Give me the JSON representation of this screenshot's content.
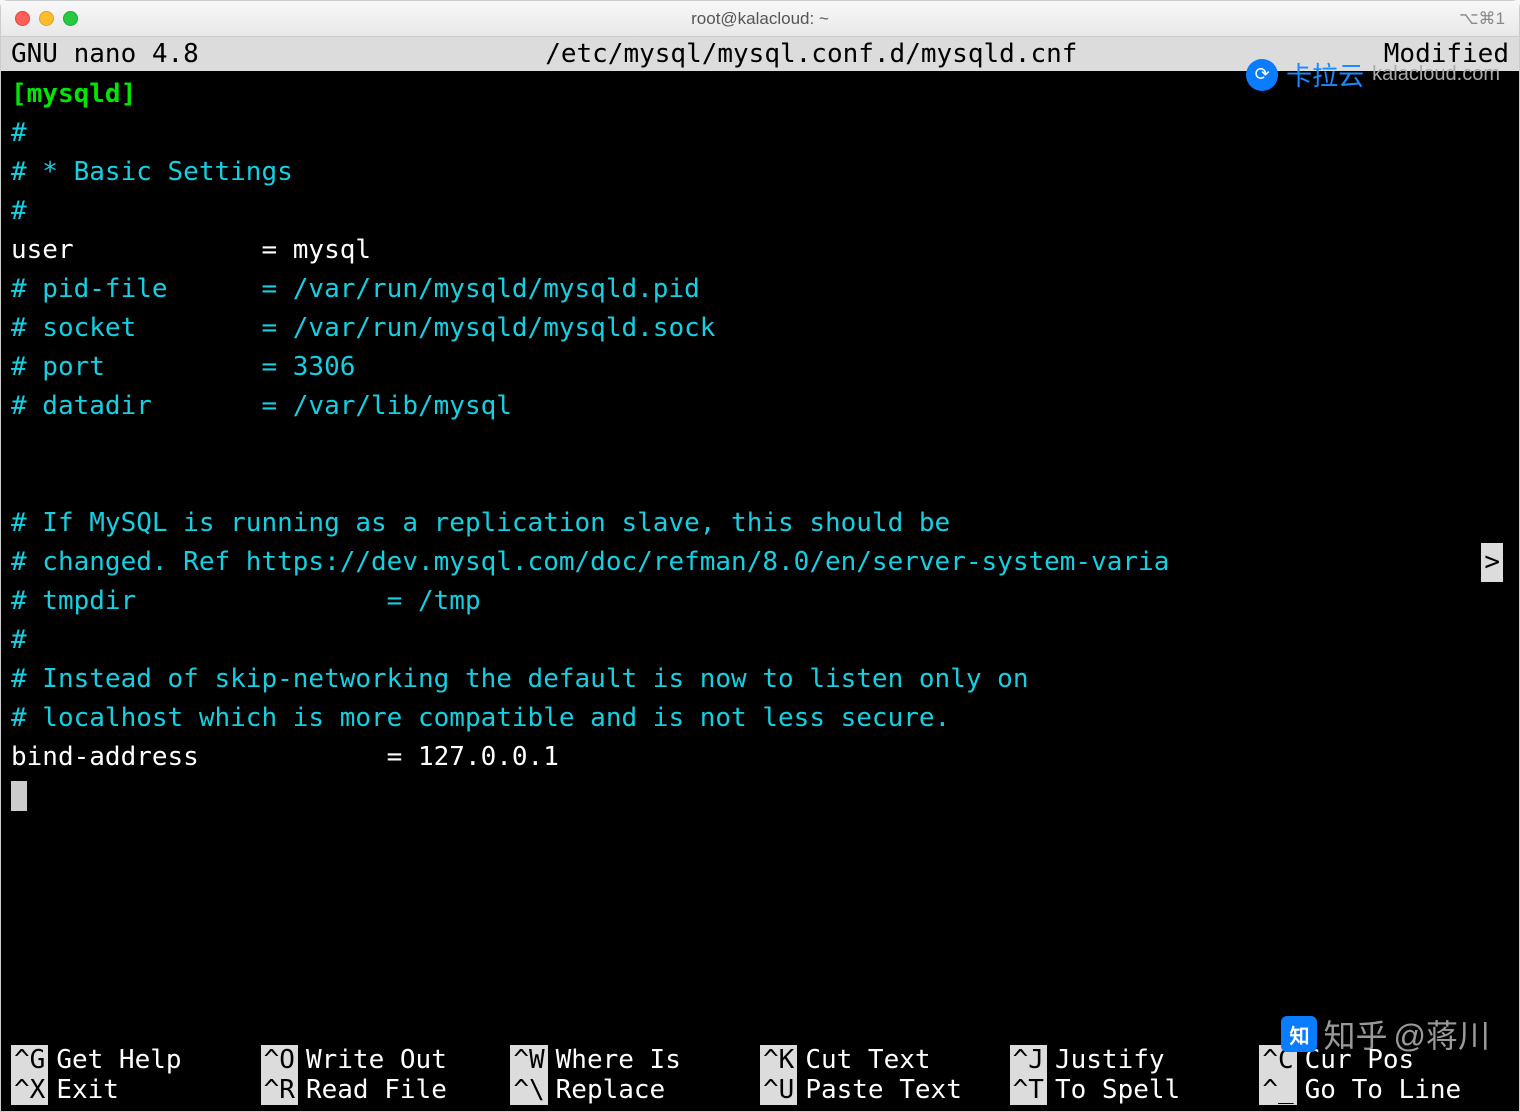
{
  "titlebar": {
    "title": "root@kalacloud: ~",
    "right_icons": "⌥⌘1"
  },
  "nano_header": {
    "app": "  GNU nano 4.8",
    "filepath": "/etc/mysql/mysql.conf.d/mysqld.cnf",
    "status": "Modified"
  },
  "watermark_top": {
    "brand_cn": "卡拉云",
    "brand_en": "kalacloud.com"
  },
  "watermark_bottom": {
    "platform": "知乎",
    "author": "@蒋川"
  },
  "content": {
    "lines": [
      {
        "cls": "green-bold",
        "text": "[mysqld]"
      },
      {
        "cls": "cyan",
        "text": "#"
      },
      {
        "cls": "cyan",
        "text": "# * Basic Settings"
      },
      {
        "cls": "cyan",
        "text": "#"
      },
      {
        "cls": "white",
        "text": "user            = mysql"
      },
      {
        "cls": "cyan",
        "text": "# pid-file      = /var/run/mysqld/mysqld.pid"
      },
      {
        "cls": "cyan",
        "text": "# socket        = /var/run/mysqld/mysqld.sock"
      },
      {
        "cls": "cyan",
        "text": "# port          = 3306"
      },
      {
        "cls": "cyan",
        "text": "# datadir       = /var/lib/mysql"
      },
      {
        "cls": "white",
        "text": ""
      },
      {
        "cls": "white",
        "text": ""
      },
      {
        "cls": "cyan",
        "text": "# If MySQL is running as a replication slave, this should be"
      },
      {
        "cls": "cyan",
        "text": "# changed. Ref https://dev.mysql.com/doc/refman/8.0/en/server-system-varia",
        "overflow": ">"
      },
      {
        "cls": "cyan",
        "text": "# tmpdir                = /tmp"
      },
      {
        "cls": "cyan",
        "text": "#"
      },
      {
        "cls": "cyan",
        "text": "# Instead of skip-networking the default is now to listen only on"
      },
      {
        "cls": "cyan",
        "text": "# localhost which is more compatible and is not less secure."
      },
      {
        "cls": "white",
        "text": "bind-address            = 127.0.0.1"
      }
    ]
  },
  "shortcuts": [
    {
      "key": "^G",
      "label": "Get Help"
    },
    {
      "key": "^O",
      "label": "Write Out"
    },
    {
      "key": "^W",
      "label": "Where Is"
    },
    {
      "key": "^K",
      "label": "Cut Text"
    },
    {
      "key": "^J",
      "label": "Justify"
    },
    {
      "key": "^C",
      "label": "Cur Pos"
    },
    {
      "key": "^X",
      "label": "Exit"
    },
    {
      "key": "^R",
      "label": "Read File"
    },
    {
      "key": "^\\",
      "label": "Replace"
    },
    {
      "key": "^U",
      "label": "Paste Text"
    },
    {
      "key": "^T",
      "label": "To Spell"
    },
    {
      "key": "^_",
      "label": "Go To Line"
    }
  ]
}
